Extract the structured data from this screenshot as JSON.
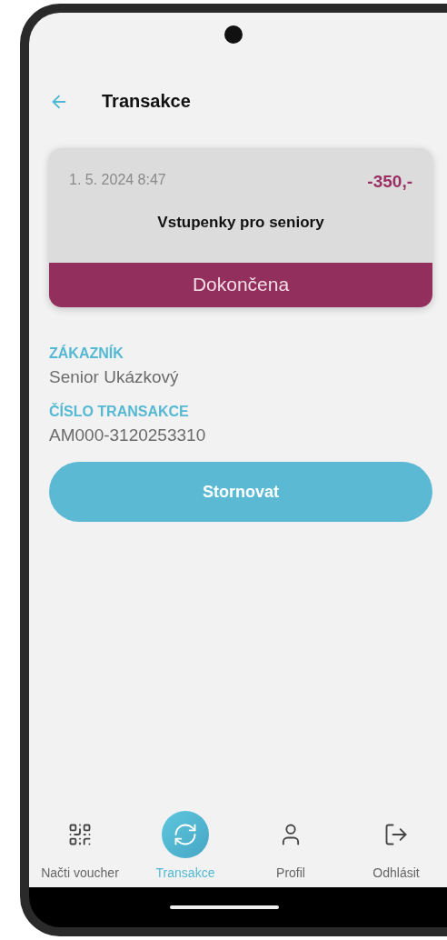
{
  "header": {
    "title": "Transakce"
  },
  "transaction": {
    "date": "1. 5. 2024 8:47",
    "amount": "-350,-",
    "name": "Vstupenky pro seniory",
    "status": "Dokončena"
  },
  "fields": [
    {
      "label": "ZÁKAZNÍK",
      "value": "Senior Ukázkový"
    },
    {
      "label": "ČÍSLO TRANSAKCE",
      "value": "AM000-3120253310"
    }
  ],
  "action_button": "Stornovat",
  "nav": [
    {
      "kind": "qr",
      "label": "Načti voucher",
      "selected": false
    },
    {
      "kind": "sync",
      "label": "Transakce",
      "selected": true
    },
    {
      "kind": "person",
      "label": "Profil",
      "selected": false
    },
    {
      "kind": "logout",
      "label": "Odhlásit",
      "selected": false
    }
  ]
}
